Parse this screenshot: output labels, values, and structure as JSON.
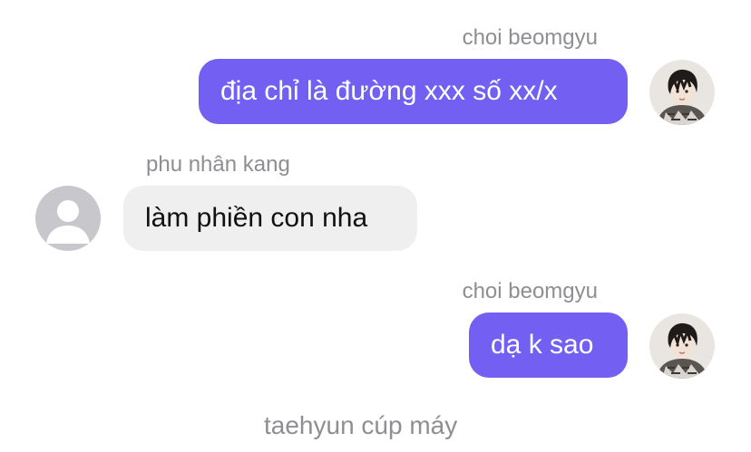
{
  "messages": [
    {
      "sender": "choi beomgyu",
      "text": "địa chỉ là đường xxx số xx/x",
      "direction": "outgoing",
      "avatar_icon": "user-photo-avatar"
    },
    {
      "sender": "phu nhân kang",
      "text": "làm phiền con nha",
      "direction": "incoming",
      "avatar_icon": "default-user-avatar"
    },
    {
      "sender": "choi beomgyu",
      "text": "dạ k sao",
      "direction": "outgoing",
      "avatar_icon": "user-photo-avatar"
    }
  ],
  "system_message": "taehyun cúp máy",
  "colors": {
    "outgoing_bubble": "#7360f2",
    "incoming_bubble": "#efefef",
    "meta_text": "#8e8e93"
  }
}
